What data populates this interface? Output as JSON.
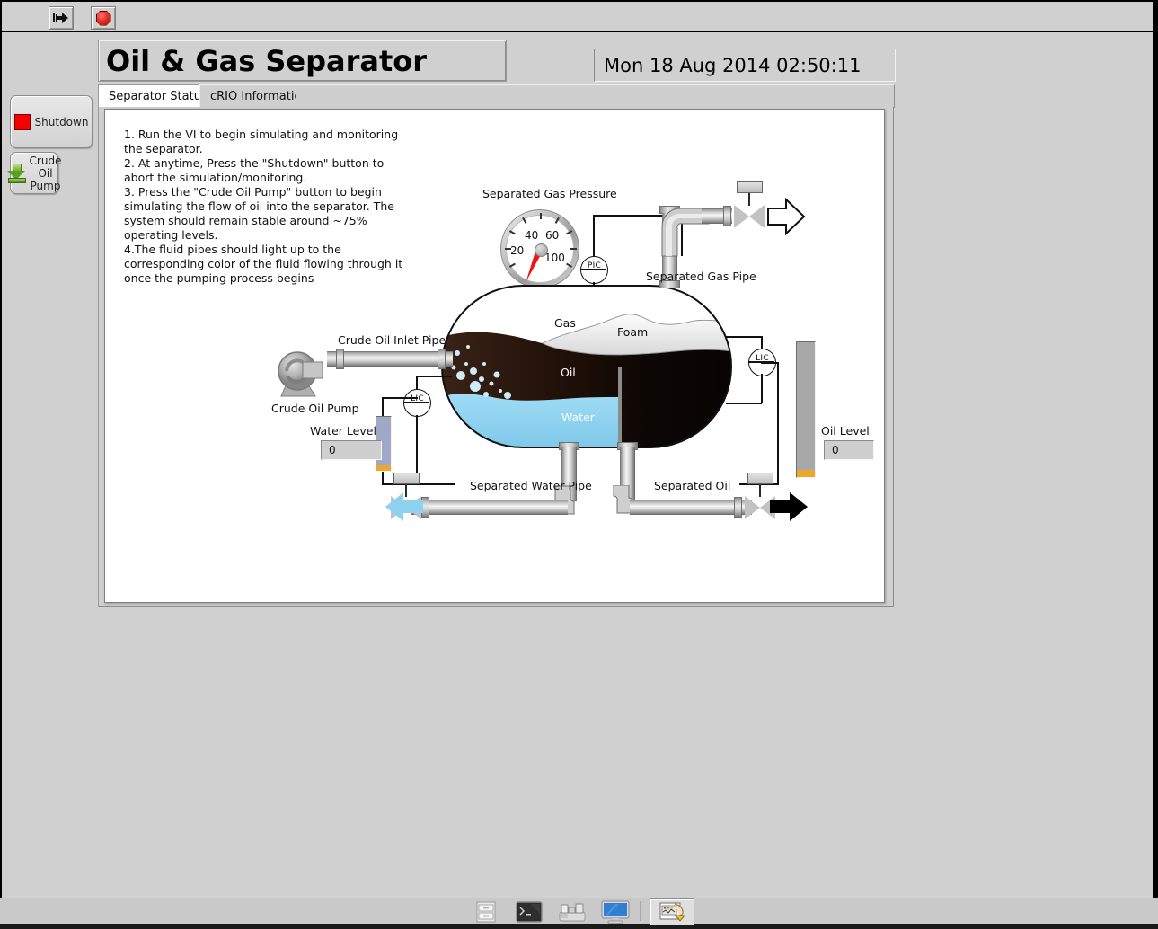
{
  "window": {
    "title": "Oil & Gas Separator",
    "datetime": "Mon 18 Aug 2014 02:50:11"
  },
  "toolbar": {
    "run_icon": "run-arrow-icon",
    "abort_icon": "abort-octagon-icon"
  },
  "controls": {
    "shutdown_label": "Shutdown",
    "pump_label_line1": "Crude Oil",
    "pump_label_line2": "Pump"
  },
  "tabs": [
    {
      "label": "Separator Status",
      "active": true
    },
    {
      "label": "cRIO Information",
      "active": false
    }
  ],
  "instructions": [
    "1. Run the VI to begin simulating and monitoring the separator.",
    "2. At anytime, Press the \"Shutdown\" button to abort the simulation/monitoring.",
    "3. Press the \"Crude Oil Pump\" button to begin simulating the flow of oil into the separator. The system should remain stable around ~75% operating levels.",
    "4.The fluid pipes should light up to the corresponding color of the fluid flowing through it once the pumping process begins"
  ],
  "diagram": {
    "gauge": {
      "title": "Separated Gas Pressure",
      "ticks": [
        "20",
        "40",
        "60",
        "100"
      ],
      "value": 0,
      "min": 0,
      "max": 100,
      "needle_color": "#f01515"
    },
    "vessel_layers": {
      "gas": "Gas",
      "foam": "Foam",
      "oil": "Oil",
      "water": "Water",
      "gas_color": "#ffffff",
      "foam_color": "#ececec",
      "oil_color": "#120a06",
      "water_color": "#8ed2f0"
    },
    "labels": {
      "crude_oil_inlet_pipe": "Crude Oil Inlet Pipe",
      "crude_oil_pump": "Crude Oil Pump",
      "separated_gas_pipe": "Separated Gas Pipe",
      "separated_water_pipe": "Separated Water Pipe",
      "separated_oil": "Separated Oil"
    },
    "instruments": {
      "pressure_controller": "PIC",
      "level_controller_left": "LIC",
      "level_controller_right": "LIC"
    },
    "water_level": {
      "label": "Water Level",
      "value": "0"
    },
    "oil_level": {
      "label": "Oil Level",
      "value": "0"
    }
  },
  "taskbar": {
    "items": [
      {
        "icon": "file-cabinet-icon"
      },
      {
        "icon": "terminal-icon"
      },
      {
        "icon": "package-manager-icon"
      },
      {
        "icon": "display-monitor-icon"
      }
    ],
    "active_window": {
      "icon": "labview-vi-icon"
    }
  }
}
